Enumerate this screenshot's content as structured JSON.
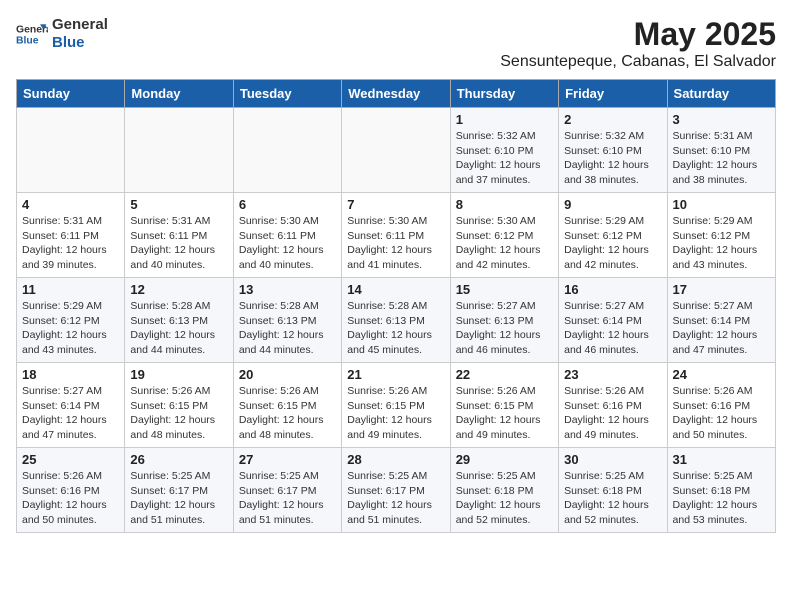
{
  "header": {
    "logo_general": "General",
    "logo_blue": "Blue",
    "title": "May 2025",
    "subtitle": "Sensuntepeque, Cabanas, El Salvador"
  },
  "days_of_week": [
    "Sunday",
    "Monday",
    "Tuesday",
    "Wednesday",
    "Thursday",
    "Friday",
    "Saturday"
  ],
  "weeks": [
    [
      {
        "day": "",
        "info": ""
      },
      {
        "day": "",
        "info": ""
      },
      {
        "day": "",
        "info": ""
      },
      {
        "day": "",
        "info": ""
      },
      {
        "day": "1",
        "info": "Sunrise: 5:32 AM\nSunset: 6:10 PM\nDaylight: 12 hours and 37 minutes."
      },
      {
        "day": "2",
        "info": "Sunrise: 5:32 AM\nSunset: 6:10 PM\nDaylight: 12 hours and 38 minutes."
      },
      {
        "day": "3",
        "info": "Sunrise: 5:31 AM\nSunset: 6:10 PM\nDaylight: 12 hours and 38 minutes."
      }
    ],
    [
      {
        "day": "4",
        "info": "Sunrise: 5:31 AM\nSunset: 6:11 PM\nDaylight: 12 hours and 39 minutes."
      },
      {
        "day": "5",
        "info": "Sunrise: 5:31 AM\nSunset: 6:11 PM\nDaylight: 12 hours and 40 minutes."
      },
      {
        "day": "6",
        "info": "Sunrise: 5:30 AM\nSunset: 6:11 PM\nDaylight: 12 hours and 40 minutes."
      },
      {
        "day": "7",
        "info": "Sunrise: 5:30 AM\nSunset: 6:11 PM\nDaylight: 12 hours and 41 minutes."
      },
      {
        "day": "8",
        "info": "Sunrise: 5:30 AM\nSunset: 6:12 PM\nDaylight: 12 hours and 42 minutes."
      },
      {
        "day": "9",
        "info": "Sunrise: 5:29 AM\nSunset: 6:12 PM\nDaylight: 12 hours and 42 minutes."
      },
      {
        "day": "10",
        "info": "Sunrise: 5:29 AM\nSunset: 6:12 PM\nDaylight: 12 hours and 43 minutes."
      }
    ],
    [
      {
        "day": "11",
        "info": "Sunrise: 5:29 AM\nSunset: 6:12 PM\nDaylight: 12 hours and 43 minutes."
      },
      {
        "day": "12",
        "info": "Sunrise: 5:28 AM\nSunset: 6:13 PM\nDaylight: 12 hours and 44 minutes."
      },
      {
        "day": "13",
        "info": "Sunrise: 5:28 AM\nSunset: 6:13 PM\nDaylight: 12 hours and 44 minutes."
      },
      {
        "day": "14",
        "info": "Sunrise: 5:28 AM\nSunset: 6:13 PM\nDaylight: 12 hours and 45 minutes."
      },
      {
        "day": "15",
        "info": "Sunrise: 5:27 AM\nSunset: 6:13 PM\nDaylight: 12 hours and 46 minutes."
      },
      {
        "day": "16",
        "info": "Sunrise: 5:27 AM\nSunset: 6:14 PM\nDaylight: 12 hours and 46 minutes."
      },
      {
        "day": "17",
        "info": "Sunrise: 5:27 AM\nSunset: 6:14 PM\nDaylight: 12 hours and 47 minutes."
      }
    ],
    [
      {
        "day": "18",
        "info": "Sunrise: 5:27 AM\nSunset: 6:14 PM\nDaylight: 12 hours and 47 minutes."
      },
      {
        "day": "19",
        "info": "Sunrise: 5:26 AM\nSunset: 6:15 PM\nDaylight: 12 hours and 48 minutes."
      },
      {
        "day": "20",
        "info": "Sunrise: 5:26 AM\nSunset: 6:15 PM\nDaylight: 12 hours and 48 minutes."
      },
      {
        "day": "21",
        "info": "Sunrise: 5:26 AM\nSunset: 6:15 PM\nDaylight: 12 hours and 49 minutes."
      },
      {
        "day": "22",
        "info": "Sunrise: 5:26 AM\nSunset: 6:15 PM\nDaylight: 12 hours and 49 minutes."
      },
      {
        "day": "23",
        "info": "Sunrise: 5:26 AM\nSunset: 6:16 PM\nDaylight: 12 hours and 49 minutes."
      },
      {
        "day": "24",
        "info": "Sunrise: 5:26 AM\nSunset: 6:16 PM\nDaylight: 12 hours and 50 minutes."
      }
    ],
    [
      {
        "day": "25",
        "info": "Sunrise: 5:26 AM\nSunset: 6:16 PM\nDaylight: 12 hours and 50 minutes."
      },
      {
        "day": "26",
        "info": "Sunrise: 5:25 AM\nSunset: 6:17 PM\nDaylight: 12 hours and 51 minutes."
      },
      {
        "day": "27",
        "info": "Sunrise: 5:25 AM\nSunset: 6:17 PM\nDaylight: 12 hours and 51 minutes."
      },
      {
        "day": "28",
        "info": "Sunrise: 5:25 AM\nSunset: 6:17 PM\nDaylight: 12 hours and 51 minutes."
      },
      {
        "day": "29",
        "info": "Sunrise: 5:25 AM\nSunset: 6:18 PM\nDaylight: 12 hours and 52 minutes."
      },
      {
        "day": "30",
        "info": "Sunrise: 5:25 AM\nSunset: 6:18 PM\nDaylight: 12 hours and 52 minutes."
      },
      {
        "day": "31",
        "info": "Sunrise: 5:25 AM\nSunset: 6:18 PM\nDaylight: 12 hours and 53 minutes."
      }
    ]
  ]
}
